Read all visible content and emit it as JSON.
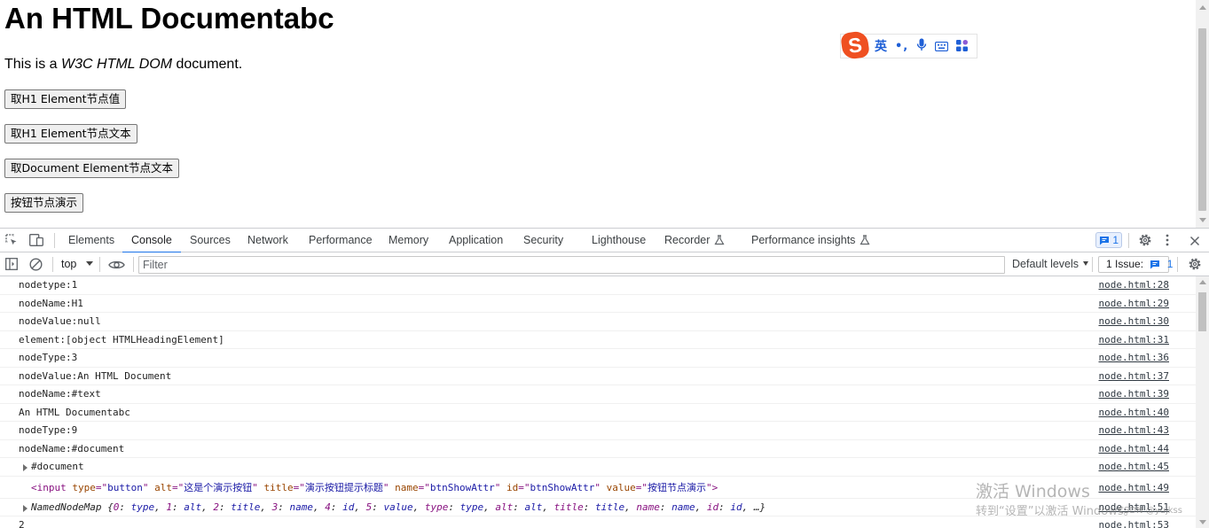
{
  "page": {
    "heading": "An HTML Documentabc",
    "paragraph": {
      "before": "This is a ",
      "emphasis": "W3C HTML DOM",
      "after": " document."
    },
    "buttons": [
      "取H1 Element节点值",
      "取H1 Element节点文本",
      "取Document Element节点文本",
      "按钮节点演示"
    ]
  },
  "ime_toolbar": {
    "logo": "S",
    "mode": "英",
    "punct": "•,"
  },
  "devtools": {
    "tabs": [
      "Elements",
      "Console",
      "Sources",
      "Network",
      "Performance",
      "Memory",
      "Application",
      "Security",
      "Lighthouse",
      "Recorder",
      "Performance insights"
    ],
    "active_tab": "Console",
    "issue_badge_count": "1",
    "toolbar": {
      "context": "top",
      "filter_placeholder": "Filter",
      "levels": "Default levels",
      "issues_label": "1 Issue:",
      "issues_count": "1"
    },
    "console": [
      {
        "msg": "nodetype:1",
        "src": "node.html:28"
      },
      {
        "msg": "nodeName:H1",
        "src": "node.html:29"
      },
      {
        "msg": "nodeValue:null",
        "src": "node.html:30"
      },
      {
        "msg": "element:[object HTMLHeadingElement]",
        "src": "node.html:31"
      },
      {
        "msg": "nodeType:3",
        "src": "node.html:36"
      },
      {
        "msg": "nodeValue:An HTML Document",
        "src": "node.html:37"
      },
      {
        "msg": "nodeName:#text",
        "src": "node.html:39"
      },
      {
        "msg": "An HTML Documentabc",
        "src": "node.html:40"
      },
      {
        "msg": "nodeType:9",
        "src": "node.html:43"
      },
      {
        "msg": "nodeName:#document",
        "src": "node.html:44"
      },
      {
        "msg": "#document",
        "src": "node.html:45"
      },
      {
        "node": {
          "tag": "input",
          "attrs": [
            {
              "name": "type",
              "value": "button"
            },
            {
              "name": "alt",
              "value": "这是个演示按钮"
            },
            {
              "name": "title",
              "value": "演示按钮提示标题"
            },
            {
              "name": "name",
              "value": "btnShowAttr"
            },
            {
              "name": "id",
              "value": "btnShowAttr"
            },
            {
              "name": "value",
              "value": "按钮节点演示"
            }
          ]
        },
        "src": "node.html:49"
      },
      {
        "msg": "NamedNodeMap {0: type, 1: alt, 2: title, 3: name, 4: id, 5: value, type: type, alt: alt, title: title, name: name, id: id, …}",
        "src": "node.html:51"
      },
      {
        "msg": "2",
        "src": "node.html:53"
      }
    ]
  },
  "watermark": {
    "line1": "激活 Windows",
    "line2": "转到“设置”以激活 Windows。",
    "credit": "CSDN @yujkss"
  },
  "colors": {
    "accent": "#1a73e8",
    "tag": "#881280",
    "attr_name": "#994500",
    "attr_value": "#1a1aa6",
    "ime_logo": "#ef5021"
  }
}
